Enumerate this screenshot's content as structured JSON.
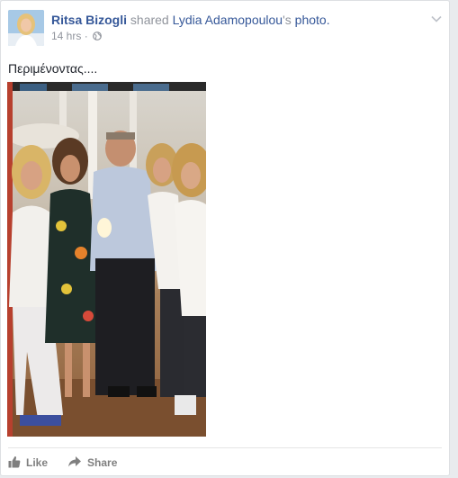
{
  "post": {
    "author": "Ritsa Bizogli",
    "action_text": "shared",
    "original_author": "Lydia Adamopoulou",
    "possessive": "'s",
    "object": "photo.",
    "timestamp": "14 hrs",
    "separator": "·",
    "privacy_icon": "globe-icon",
    "text": "Περιμένοντας...."
  },
  "actions": {
    "like_label": "Like",
    "share_label": "Share"
  },
  "colors": {
    "link": "#365899",
    "muted": "#90949c",
    "action": "#7f7f7f",
    "background": "#e9ebee"
  }
}
